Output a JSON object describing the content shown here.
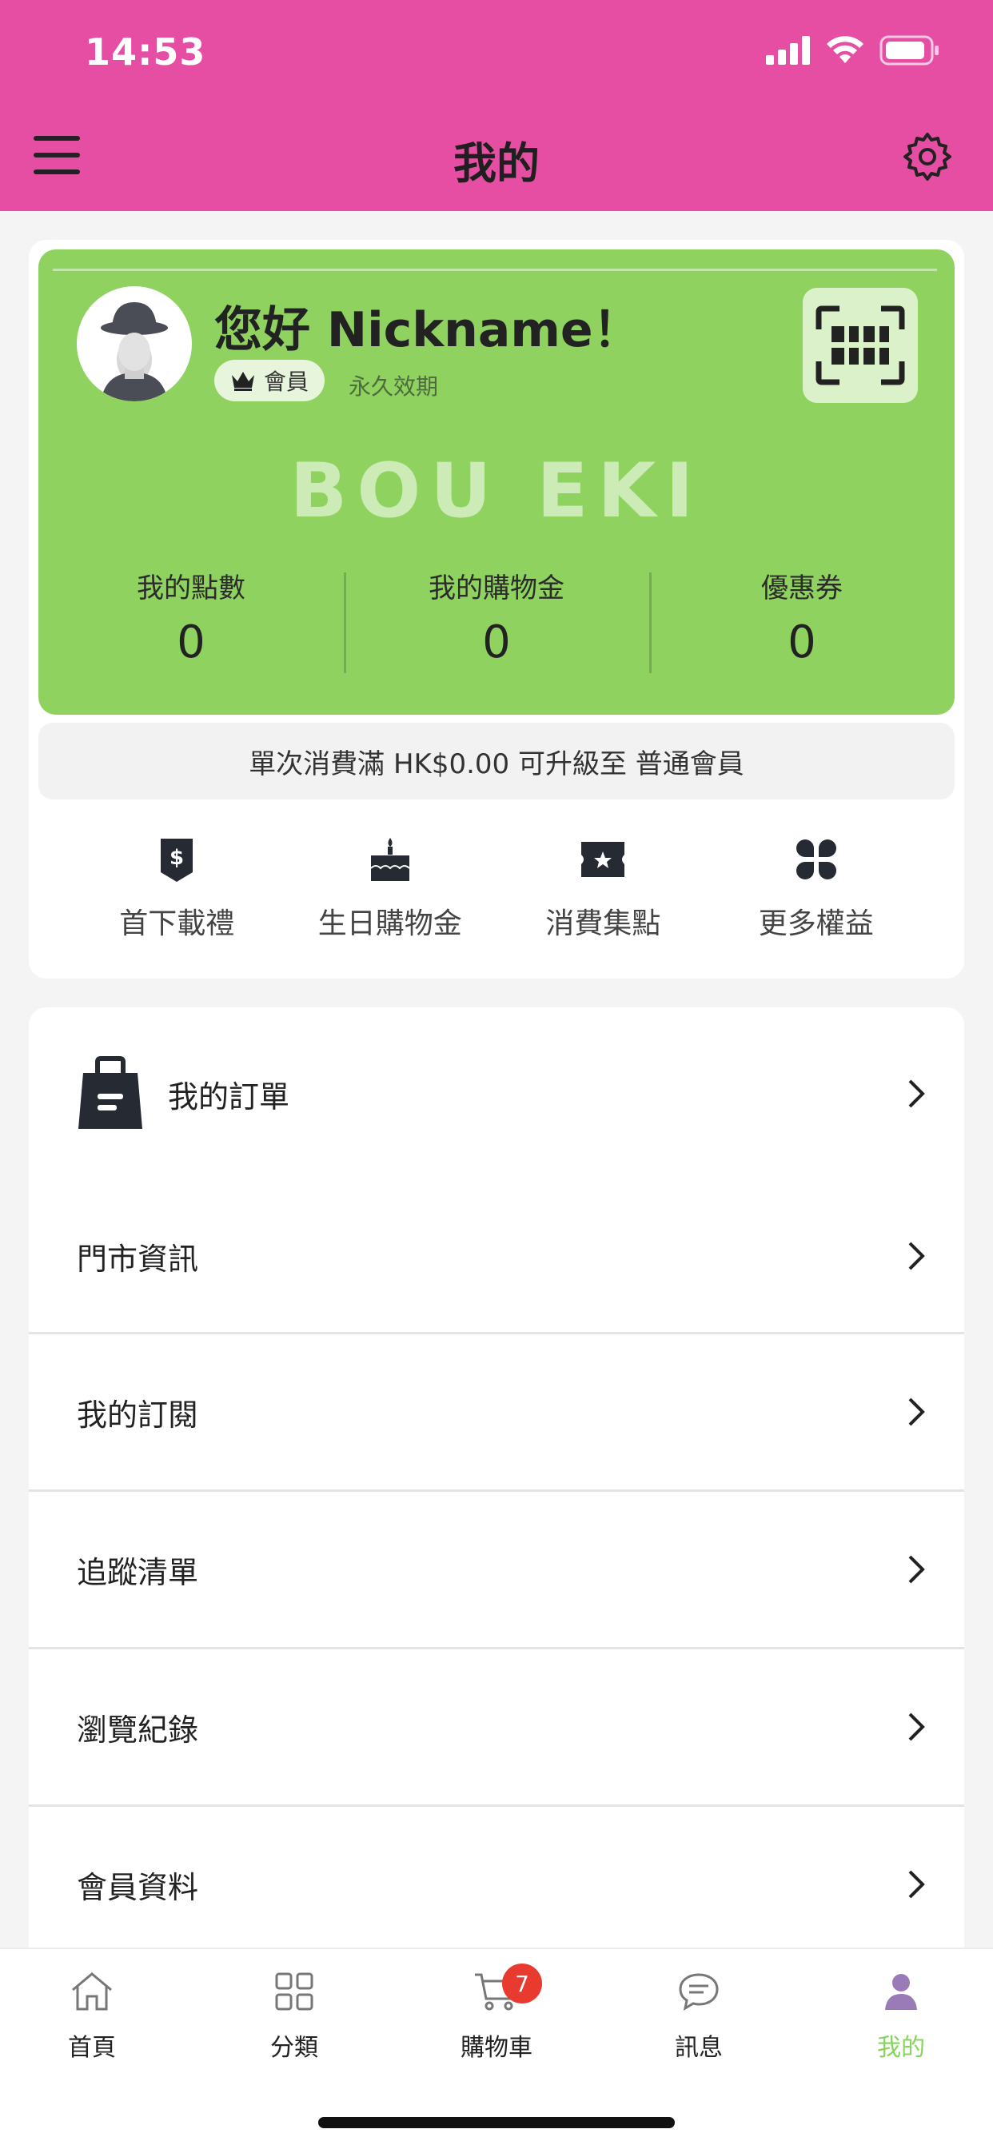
{
  "status": {
    "time": "14:53"
  },
  "header": {
    "title": "我的"
  },
  "member": {
    "greeting": "您好 Nickname！",
    "badge": "會員",
    "validity": "永久效期",
    "brand_watermark": "BOU EKI",
    "stats": [
      {
        "label": "我的點數",
        "value": "0"
      },
      {
        "label": "我的購物金",
        "value": "0"
      },
      {
        "label": "優惠券",
        "value": "0"
      }
    ],
    "upgrade_text": "單次消費滿 HK$0.00 可升級至 普通會員"
  },
  "benefits": [
    {
      "label": "首下載禮",
      "icon": "download-gift-icon"
    },
    {
      "label": "生日購物金",
      "icon": "birthday-cake-icon"
    },
    {
      "label": "消費集點",
      "icon": "star-ticket-icon"
    },
    {
      "label": "更多權益",
      "icon": "more-benefits-icon"
    }
  ],
  "menu": {
    "orders": "我的訂單",
    "items": [
      "門市資訊",
      "我的訂閱",
      "追蹤清單",
      "瀏覽紀錄",
      "會員資料"
    ]
  },
  "tabbar": {
    "tabs": [
      "首頁",
      "分類",
      "購物車",
      "訊息",
      "我的"
    ],
    "cart_count": "7",
    "active_color": "#85d45e"
  },
  "colors": {
    "header": "#e64ea4",
    "card": "#8fd25f",
    "badge_red": "#e83a2f"
  }
}
